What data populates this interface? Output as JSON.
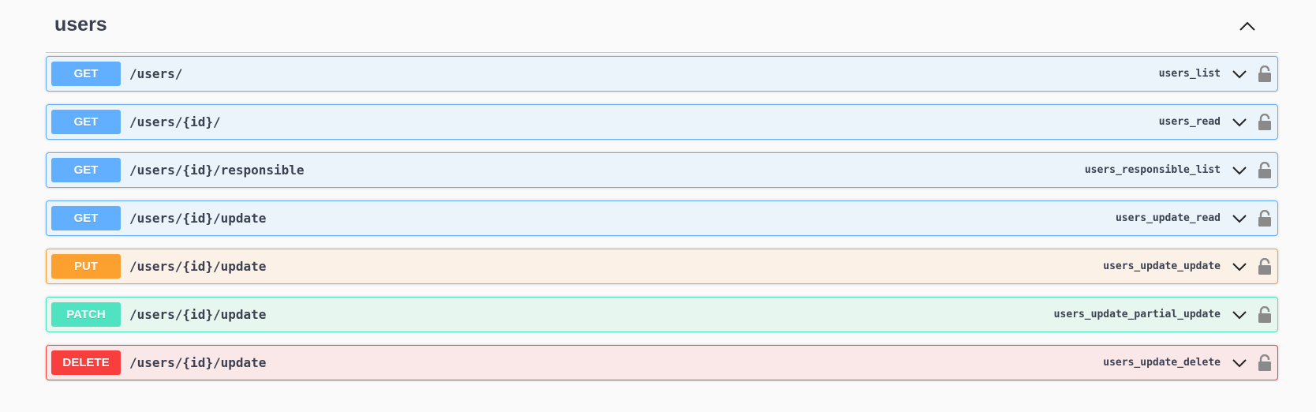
{
  "section": {
    "title": "users"
  },
  "icons": {
    "collapse": "chevron-up-icon",
    "expand": "chevron-down-icon",
    "lock": "unlocked-padlock-icon"
  },
  "colors": {
    "get": "#61affe",
    "put": "#fca130",
    "patch": "#50e3c2",
    "delete": "#f93e3e"
  },
  "operations": [
    {
      "method": "GET",
      "path": "/users/",
      "operation_id": "users_list"
    },
    {
      "method": "GET",
      "path": "/users/{id}/",
      "operation_id": "users_read"
    },
    {
      "method": "GET",
      "path": "/users/{id}/responsible",
      "operation_id": "users_responsible_list"
    },
    {
      "method": "GET",
      "path": "/users/{id}/update",
      "operation_id": "users_update_read"
    },
    {
      "method": "PUT",
      "path": "/users/{id}/update",
      "operation_id": "users_update_update"
    },
    {
      "method": "PATCH",
      "path": "/users/{id}/update",
      "operation_id": "users_update_partial_update"
    },
    {
      "method": "DELETE",
      "path": "/users/{id}/update",
      "operation_id": "users_update_delete"
    }
  ]
}
